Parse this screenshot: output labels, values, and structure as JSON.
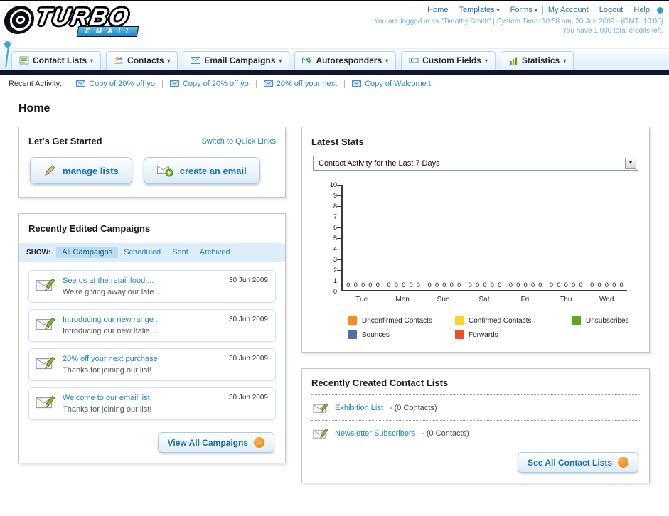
{
  "icons": {
    "caret": "▾",
    "dropdown_caret": "▼",
    "arrow": "→"
  },
  "header": {
    "logo_title": "TURBO",
    "logo_subtitle": "EMAIL",
    "links": [
      "Home",
      "Templates",
      "Forms",
      "My Account",
      "Logout",
      "Help"
    ],
    "login_info": "You are logged in as \"Timothy Smith\" | System Time: 10:58 am, 30 Jun 2009 - (GMT+10:00)",
    "credits_info": "You have 1,000 total credits left."
  },
  "nav": {
    "items": [
      {
        "label": "Contact Lists"
      },
      {
        "label": "Contacts"
      },
      {
        "label": "Email Campaigns"
      },
      {
        "label": "Autoresponders"
      },
      {
        "label": "Custom Fields"
      },
      {
        "label": "Statistics"
      }
    ]
  },
  "recent_activity": {
    "label": "Recent Activity:",
    "items": [
      "Copy of 20% off yo",
      "Copy of 20% off yo",
      "20% off your next",
      "Copy of Welcome t"
    ]
  },
  "page_title": "Home",
  "get_started": {
    "title": "Let's Get Started",
    "switch_link": "Switch to Quick Links",
    "manage_lists_label": "manage lists",
    "create_email_label": "create an email"
  },
  "campaigns": {
    "title": "Recently Edited Campaigns",
    "show_label": "SHOW:",
    "tabs": [
      "All Campaigns",
      "Scheduled",
      "Sent",
      "Archived"
    ],
    "active_tab": "All Campaigns",
    "items": [
      {
        "title": "See us at the retail food ...",
        "subtitle": "We're giving away our late ...",
        "date": "30 Jun 2009"
      },
      {
        "title": "Introducing our new range ...",
        "subtitle": "Introducing our new Italia ...",
        "date": "30 Jun 2009"
      },
      {
        "title": "20% off your next purchase",
        "subtitle": "Thanks for joining our list!",
        "date": "30 Jun 2009"
      },
      {
        "title": "Welcome to our email list",
        "subtitle": "Thanks for joining our list!",
        "date": "30 Jun 2009"
      }
    ],
    "view_all_label": "View All Campaigns"
  },
  "latest_stats": {
    "title": "Latest Stats",
    "dropdown_value": "Contact Activity for the Last 7 Days"
  },
  "chart_data": {
    "type": "bar",
    "title": "Contact Activity for the Last 7 Days",
    "categories": [
      "Tue",
      "Mon",
      "Sun",
      "Sat",
      "Fri",
      "Thu",
      "Wed"
    ],
    "series": [
      {
        "name": "Unconfirmed Contacts",
        "color": "#f68b1f",
        "values": [
          0,
          0,
          0,
          0,
          0,
          0,
          0
        ]
      },
      {
        "name": "Confirmed Contacts",
        "color": "#f7d426",
        "values": [
          0,
          0,
          0,
          0,
          0,
          0,
          0
        ]
      },
      {
        "name": "Unsubscribes",
        "color": "#5ca81e",
        "values": [
          0,
          0,
          0,
          0,
          0,
          0,
          0
        ]
      },
      {
        "name": "Bounces",
        "color": "#4f6fa5",
        "values": [
          0,
          0,
          0,
          0,
          0,
          0,
          0
        ]
      },
      {
        "name": "Forwards",
        "color": "#e8502a",
        "values": [
          0,
          0,
          0,
          0,
          0,
          0,
          0
        ]
      }
    ],
    "xlabel": "",
    "ylabel": "",
    "ylim": [
      0,
      10
    ],
    "yticks": [
      0,
      1,
      2,
      3,
      4,
      5,
      6,
      7,
      8,
      9,
      10
    ],
    "grid": false,
    "legend_position": "bottom"
  },
  "contact_lists": {
    "title": "Recently Created Contact Lists",
    "items": [
      {
        "name": "Exhibition List",
        "suffix": "- (0 Contacts)"
      },
      {
        "name": "Newsletter Subscribers",
        "suffix": "- (0 Contacts)"
      }
    ],
    "see_all_label": "See All Contact Lists"
  }
}
